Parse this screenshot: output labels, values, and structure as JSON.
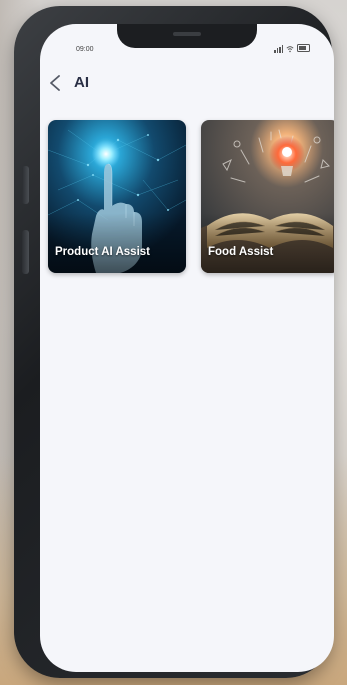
{
  "status_bar": {
    "time": "09:00",
    "icons": [
      "signal-icon",
      "wifi-icon",
      "battery-icon"
    ]
  },
  "header": {
    "back_icon": "chevron-left-icon",
    "title": "AI"
  },
  "cards": [
    {
      "label": "Product AI Assist",
      "image": "ai-hand-image"
    },
    {
      "label": "Food Assist",
      "image": "food-book-image"
    }
  ],
  "colors": {
    "screen_background": "#f5f6fa",
    "title_text": "#2a2f45",
    "card_label_text": "#ffffff",
    "phone_frame": "#1b1d20"
  }
}
